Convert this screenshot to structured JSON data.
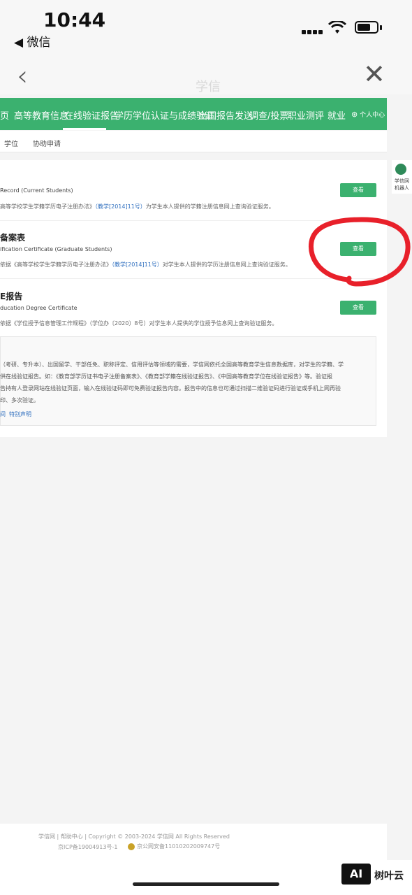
{
  "status": {
    "time": "10:44",
    "back_app": "◀ 微信"
  },
  "nav": {
    "back_icon": "‹",
    "close_icon": "✕",
    "title": "学信"
  },
  "menu": {
    "items": [
      "页",
      "高等教育信息",
      "在线验证报告",
      "学历学位认证与成绩验证",
      "出国报告发送",
      "调查/投票",
      "职业测评",
      "就业"
    ],
    "personal": "个人中心"
  },
  "submenu": [
    "学位",
    "协助申请"
  ],
  "rows": [
    {
      "title": "",
      "subtitle": "Record (Current Students)",
      "desc_before": "高等学校学生学籍学历电子注册办法》",
      "desc_link": "（教学[2014]11号）",
      "desc_after": "为学生本人提供的学籍注册信息网上查询验证服务。",
      "button": "查看"
    },
    {
      "title": "备案表",
      "subtitle": "ification Certificate (Graduate Students)",
      "desc_before": "依据《高等学校学生学籍学历电子注册办法》",
      "desc_link": "（教学[2014]11号）",
      "desc_after": "对学生本人提供的学历注册信息网上查询验证服务。",
      "button": "查看"
    },
    {
      "title": "E报告",
      "subtitle": "ducation Degree Certificate",
      "desc_before": "依据《学位授予信息管理工作规程》（学位办〔2020〕8号）对学生本人提供的学位授予信息网上查询验证服务。",
      "desc_link": "",
      "desc_after": "",
      "button": "查看"
    }
  ],
  "notice": {
    "lines": [
      "（考研、专升本）、出国留学、干部任免、职称评定、信用评估等领域的需要，学信网依托全国高等教育学生信息数据库，对学生的学籍、学",
      "供在线验证报告。如：《教育部学历证书电子注册备案表》、《教育部学籍在线验证报告》、《中国高等教育学位在线验证报告》等。验证报",
      "告持有人登录网站在线验证页面，输入在线验证码即可免费验证报告内容。报告中的信息也可通过扫描二维验证码进行验证或手机上网再验",
      "印、多次验证。"
    ],
    "link_left": "间",
    "link_right": "特别声明"
  },
  "robot": {
    "label_line1": "学信网",
    "label_line2": "机器人"
  },
  "footer": {
    "line1": "学信网   |   帮助中心   |   Copyright © 2003-2024 学信网 All Rights Reserved",
    "icp": "京ICP备19004913号-1",
    "police": "京公网安备11010202009747号"
  },
  "watermark": {
    "logo": "AI",
    "text": "树叶云"
  },
  "colors": {
    "brand_green": "#3bb16f",
    "link_blue": "#2f6fbf",
    "annotation_red": "#e8202a"
  }
}
